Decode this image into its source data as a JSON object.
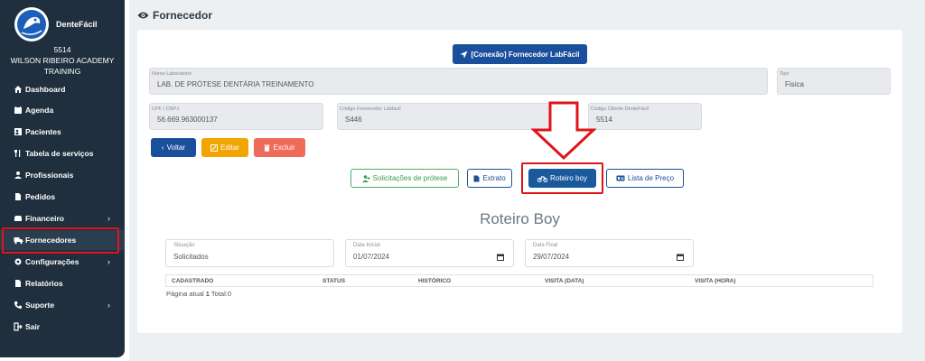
{
  "app": {
    "name": "DenteFácil"
  },
  "sidebar": {
    "account_id": "5514",
    "account_name_line1": "WILSON RIBEIRO ACADEMY",
    "account_name_line2": "TRAINING",
    "items": [
      {
        "label": "Dashboard",
        "icon": "home-icon"
      },
      {
        "label": "Agenda",
        "icon": "calendar-icon"
      },
      {
        "label": "Pacientes",
        "icon": "users-icon"
      },
      {
        "label": "Tabela de serviços",
        "icon": "utensils-icon"
      },
      {
        "label": "Profissionais",
        "icon": "user-icon"
      },
      {
        "label": "Pedidos",
        "icon": "file-icon"
      },
      {
        "label": "Financeiro",
        "icon": "money-icon",
        "chevron": "›"
      },
      {
        "label": "Fornecedores",
        "icon": "truck-icon"
      },
      {
        "label": "Configurações",
        "icon": "gear-icon",
        "chevron": "›"
      },
      {
        "label": "Relatórios",
        "icon": "file-icon"
      },
      {
        "label": "Suporte",
        "icon": "phone-icon",
        "chevron": "›"
      },
      {
        "label": "Sair",
        "icon": "sign-out-icon"
      }
    ],
    "active_item": "Fornecedores"
  },
  "page": {
    "title": "Fornecedor"
  },
  "connection_button": "[Conexão] Fornecedor LabFácil",
  "fields": {
    "lab_name": {
      "label": "Nome Laboratório",
      "value": "LAB. DE PRÓTESE DENTÁRIA TREINAMENTO"
    },
    "tipo": {
      "label": "Tipo",
      "value": "Fisica"
    },
    "cpf": {
      "label": "CPF / CNPJ",
      "value": "56.669.963000137"
    },
    "cod_fornecedor": {
      "label": "Código Fornecedor Labfacil",
      "value": "S446"
    },
    "cod_cliente": {
      "label": "Código Cliente DenteFácil",
      "value": "5514"
    }
  },
  "actions": {
    "back": "Voltar",
    "edit": "Editar",
    "delete": "Excluir"
  },
  "tabs": {
    "solicitacoes": "Solicitações de prótese",
    "extrato": "Extrato",
    "roteiro": "Roteiro boy",
    "lista": "Lista de Preço"
  },
  "section": {
    "title": "Roteiro Boy"
  },
  "filters": {
    "situacao": {
      "label": "Situação",
      "value": "Solicitados"
    },
    "data_inicial": {
      "label": "Data Inicial",
      "value": "01/07/2024"
    },
    "data_final": {
      "label": "Data Final",
      "value": "29/07/2024"
    }
  },
  "table": {
    "columns": [
      "CADASTRADO",
      "STATUS",
      "HISTÓRICO",
      "VISITA (DATA)",
      "VISITA (HORA)"
    ],
    "rows": []
  },
  "pager": {
    "prefix": "Página atual",
    "page": "1",
    "total_label": "Total:0"
  },
  "colors": {
    "sidebar": "#1f2f3d",
    "primary": "#1a4f9c",
    "warning": "#f0a500",
    "danger": "#f06a5a",
    "success_outline": "#4bae63",
    "highlight": "#e0141b"
  }
}
